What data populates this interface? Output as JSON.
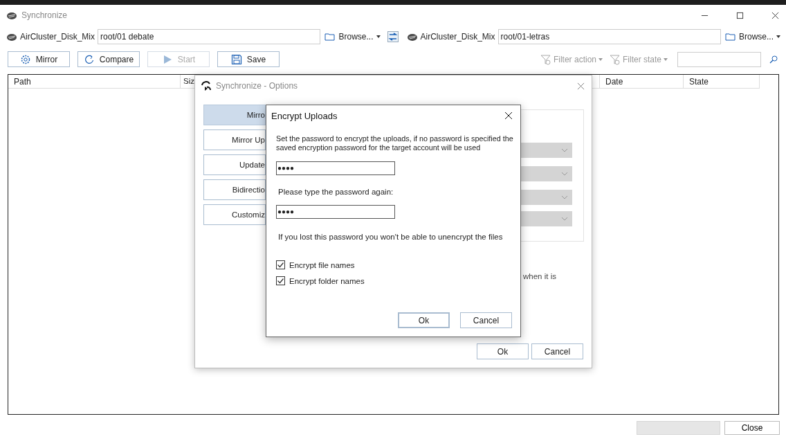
{
  "window": {
    "title": "Synchronize"
  },
  "source": {
    "account": "AirCluster_Disk_Mix",
    "path": "root/01 debate",
    "browse": "Browse..."
  },
  "target": {
    "account": "AirCluster_Disk_Mix",
    "path": "root/01-letras",
    "browse": "Browse..."
  },
  "toolbar": [
    {
      "label": "Mirror",
      "kind": "gear",
      "disabled": false
    },
    {
      "label": "Compare",
      "kind": "refresh",
      "disabled": false
    },
    {
      "label": "Start",
      "kind": "play",
      "disabled": true
    },
    {
      "label": "Save",
      "kind": "save",
      "disabled": false
    }
  ],
  "filters": [
    {
      "label": "Filter action"
    },
    {
      "label": "Filter state"
    }
  ],
  "table": {
    "columns": [
      "Path",
      "Siz",
      "Date",
      "State"
    ]
  },
  "close_button": "Close",
  "progress": {
    "level": 0
  },
  "options_dialog": {
    "title": "Synchronize - Options",
    "modes": [
      {
        "label": "Mirro",
        "selected": true
      },
      {
        "label": "Mirror Up",
        "selected": false
      },
      {
        "label": "Update",
        "selected": false
      },
      {
        "label": "Bidirectio",
        "selected": false
      },
      {
        "label": "Customiz",
        "selected": false
      }
    ],
    "note": "when it is",
    "ok": "Ok",
    "cancel": "Cancel"
  },
  "encrypt_dialog": {
    "title": "Encrypt Uploads",
    "message": "Set the password to encrypt the uploads, if no password is specified the saved encryption password for the target account will be used",
    "password": "●●●●",
    "confirm_label": "Please type the password again:",
    "confirm_password": "●●●●",
    "warning": "If you lost this password you won't be able to unencrypt the files",
    "checkboxes": [
      {
        "label": "Encrypt file names",
        "checked": true
      },
      {
        "label": "Encrypt folder names",
        "checked": true
      }
    ],
    "ok": "Ok",
    "cancel": "Cancel"
  }
}
